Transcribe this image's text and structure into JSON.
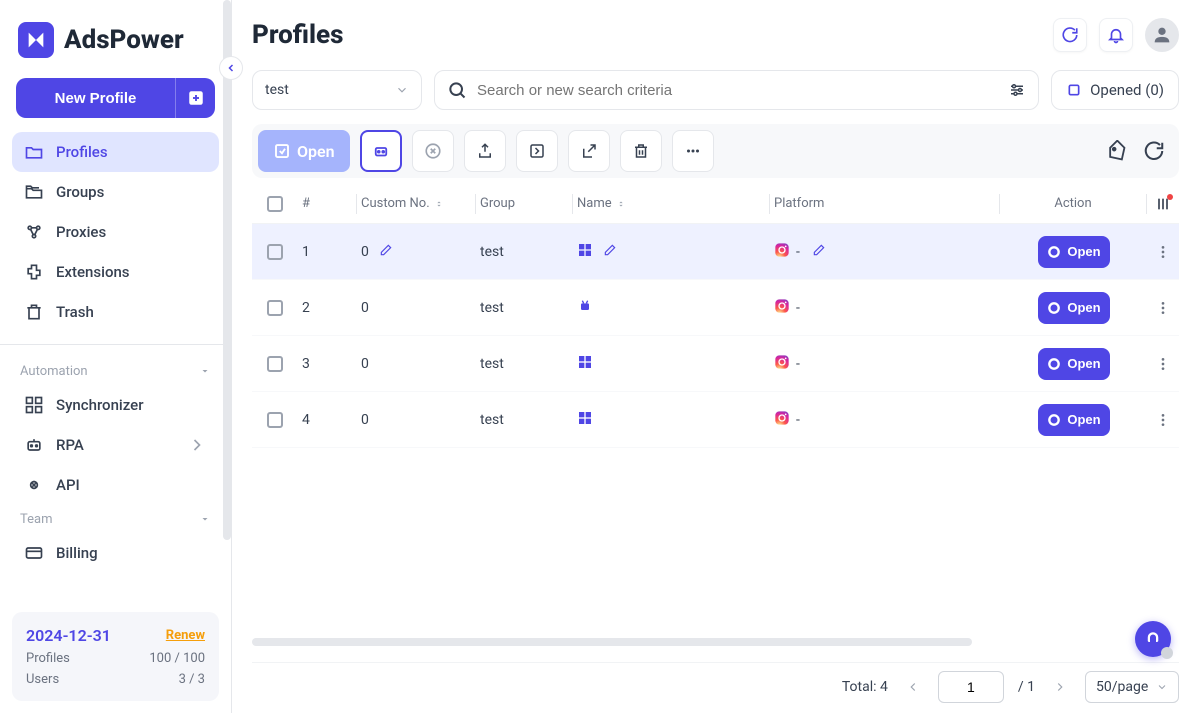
{
  "brand": "AdsPower",
  "new_profile_label": "New Profile",
  "sidebar": {
    "items": [
      {
        "label": "Profiles",
        "icon": "profiles"
      },
      {
        "label": "Groups",
        "icon": "groups"
      },
      {
        "label": "Proxies",
        "icon": "proxies"
      },
      {
        "label": "Extensions",
        "icon": "extensions"
      },
      {
        "label": "Trash",
        "icon": "trash"
      }
    ],
    "automation_label": "Automation",
    "automation_items": [
      {
        "label": "Synchronizer",
        "icon": "sync"
      },
      {
        "label": "RPA",
        "icon": "rpa"
      },
      {
        "label": "API",
        "icon": "api"
      }
    ],
    "team_label": "Team",
    "team_items": [
      {
        "label": "Billing",
        "icon": "billing"
      }
    ]
  },
  "license": {
    "expiry": "2024-12-31",
    "renew_label": "Renew",
    "profiles_label": "Profiles",
    "profiles_value": "100 / 100",
    "users_label": "Users",
    "users_value": "3 / 3"
  },
  "page_title": "Profiles",
  "group_select_value": "test",
  "search_placeholder": "Search or new search criteria",
  "opened_label": "Opened (0)",
  "toolbar_open_label": "Open",
  "table": {
    "headers": {
      "num": "#",
      "custom": "Custom No.",
      "group": "Group",
      "name": "Name",
      "platform": "Platform",
      "action": "Action"
    },
    "rows": [
      {
        "num": "1",
        "custom": "0",
        "group": "test",
        "os": "windows",
        "platform_text": "-",
        "show_edit": true,
        "show_platform_edit": true,
        "hovered": true
      },
      {
        "num": "2",
        "custom": "0",
        "group": "test",
        "os": "android",
        "platform_text": "-",
        "show_edit": false,
        "show_platform_edit": false,
        "hovered": false
      },
      {
        "num": "3",
        "custom": "0",
        "group": "test",
        "os": "windows",
        "platform_text": "-",
        "show_edit": false,
        "show_platform_edit": false,
        "hovered": false
      },
      {
        "num": "4",
        "custom": "0",
        "group": "test",
        "os": "windows",
        "platform_text": "-",
        "show_edit": false,
        "show_platform_edit": false,
        "hovered": false
      }
    ],
    "open_label": "Open"
  },
  "footer": {
    "total_label": "Total: 4",
    "page_value": "1",
    "page_count": "/ 1",
    "per_page": "50/page"
  }
}
